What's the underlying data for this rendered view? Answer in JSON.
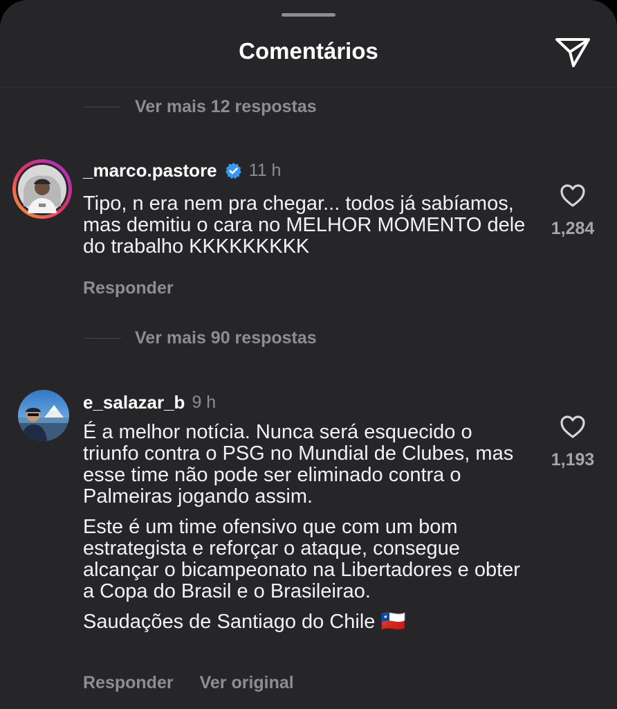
{
  "header": {
    "title": "Comentários"
  },
  "thread1": {
    "more_replies": "Ver mais 12 respostas"
  },
  "comment1": {
    "username": "_marco.pastore",
    "time": "11 h",
    "text": "Tipo, n era nem pra chegar... todos já sabíamos, mas demitiu o cara no MELHOR MOMENTO dele do trabalho KKKKKKKKK",
    "likes": "1,284",
    "reply_label": "Responder"
  },
  "thread2": {
    "more_replies": "Ver mais 90 respostas"
  },
  "comment2": {
    "username": "e_salazar_b",
    "time": "9 h",
    "paragraphs": [
      "É a melhor notícia. Nunca será esquecido o triunfo contra o PSG no Mundial de Clubes, mas esse time não pode ser eliminado contra o Palmeiras jogando assim.",
      "Este é um time ofensivo que com um bom estrategista e reforçar o ataque, consegue alcançar o bicampeonato na Libertadores e obter a Copa do Brasil e o Brasileirao.",
      "Saudações de Santiago do Chile 🇨🇱"
    ],
    "likes": "1,193",
    "reply_label": "Responder",
    "translate_label": "Ver original"
  }
}
